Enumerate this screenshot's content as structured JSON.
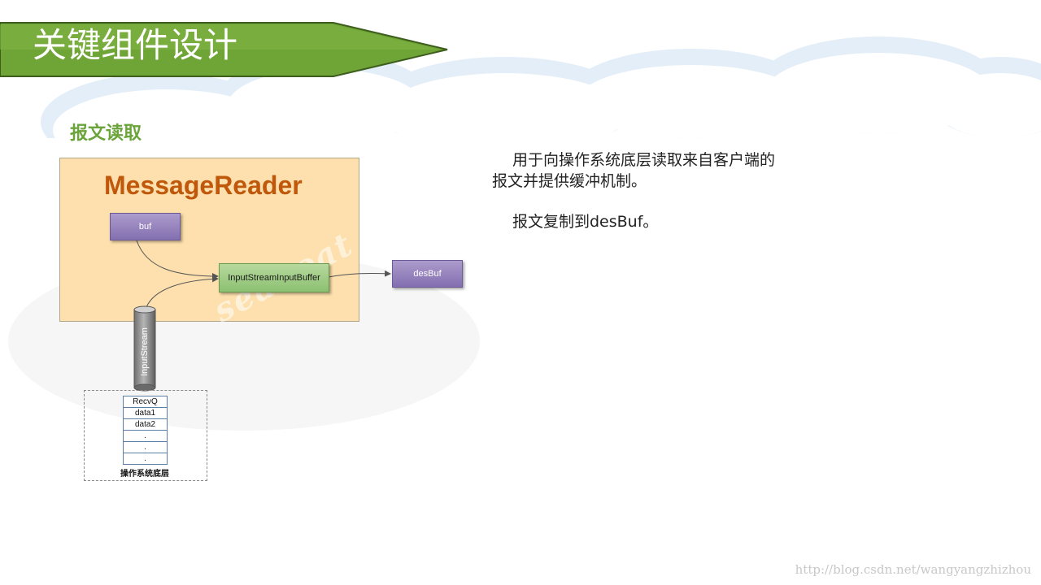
{
  "slide": {
    "title": "关键组件设计",
    "section_title": "报文读取"
  },
  "diagram": {
    "container_label": "MessageReader",
    "nodes": {
      "buf": "buf",
      "input_stream_input_buffer": "InputStreamInputBuffer",
      "des_buf": "desBuf",
      "input_stream": "InputStream"
    },
    "queue": [
      "RecvQ",
      "data1",
      "data2",
      ".",
      ".",
      "."
    ],
    "os_label": "操作系统底层",
    "colors": {
      "container_fill": "#fde0ad",
      "container_title": "#c0580b",
      "purple_node": "#9482bf",
      "green_node": "#a2cc88",
      "banner_green": "#6fa436"
    }
  },
  "description": {
    "paragraph_1": "用于向操作系统底层读取来自客户端的报文并提供缓冲机制。",
    "paragraph_2": "报文复制到desBuf。"
  },
  "watermark": "http://blog.csdn.net/wangyangzhizhou"
}
